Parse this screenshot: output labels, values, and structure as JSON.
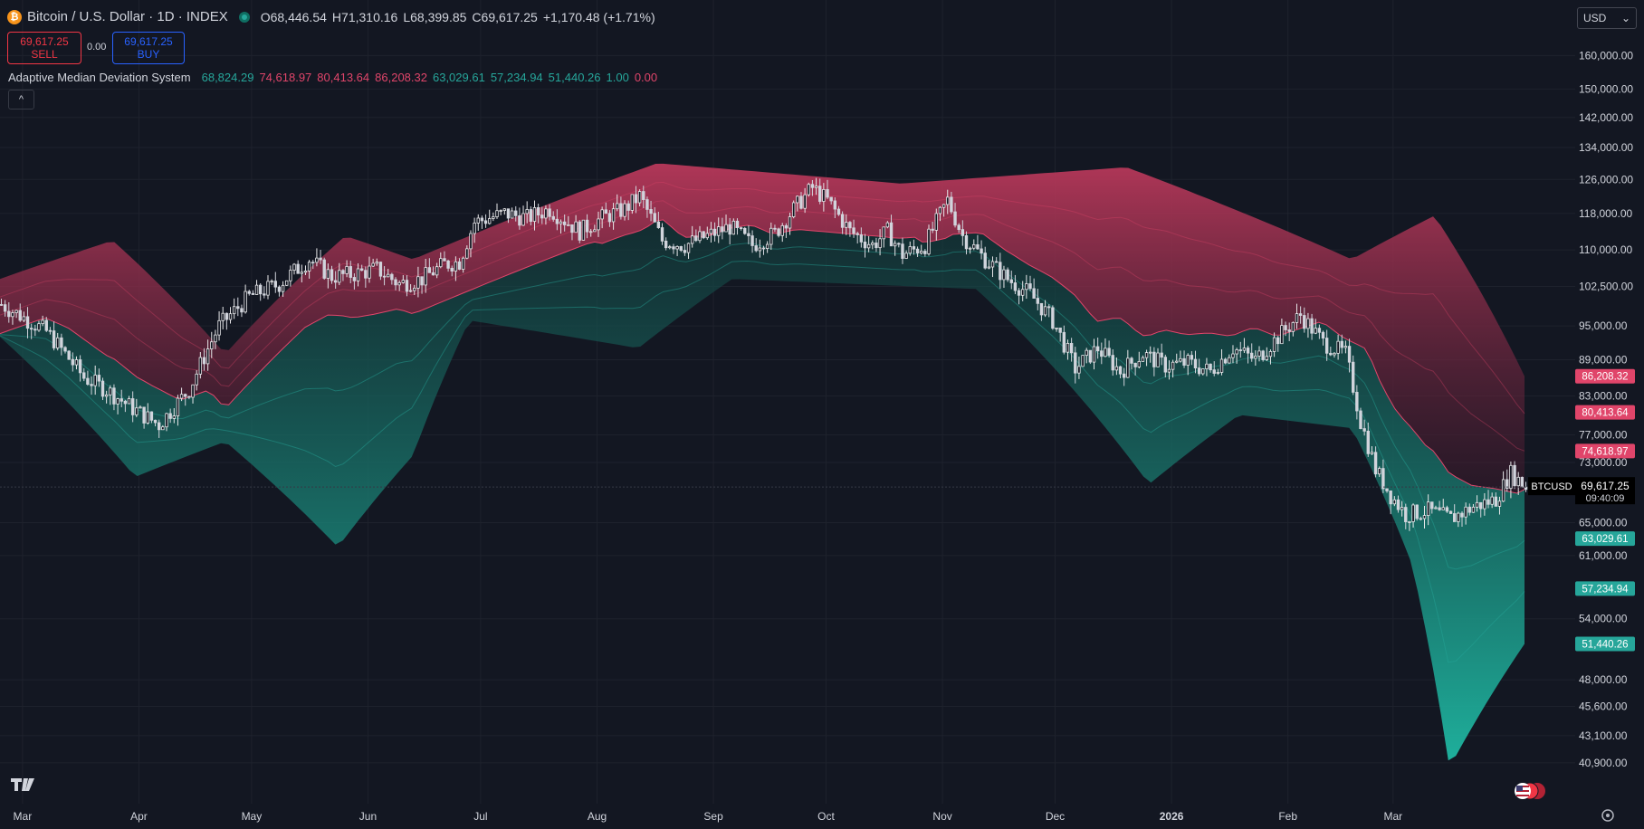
{
  "header": {
    "symbol_title": "Bitcoin / U.S. Dollar · 1D · INDEX",
    "icon": "bitcoin-icon",
    "open_label": "O",
    "open": "68,446.54",
    "high_label": "H",
    "high": "71,310.16",
    "low_label": "L",
    "low": "68,399.85",
    "close_label": "C",
    "close": "69,617.25",
    "change": "+1,170.48 (+1.71%)"
  },
  "trade": {
    "sell_price": "69,617.25",
    "sell_label": "SELL",
    "spread": "0.00",
    "buy_price": "69,617.25",
    "buy_label": "BUY"
  },
  "indicator": {
    "name": "Adaptive Median Deviation System",
    "values": [
      {
        "text": "68,824.29",
        "color": "#26a69a"
      },
      {
        "text": "74,618.97",
        "color": "#e0456a"
      },
      {
        "text": "80,413.64",
        "color": "#e0456a"
      },
      {
        "text": "86,208.32",
        "color": "#e0456a"
      },
      {
        "text": "63,029.61",
        "color": "#26a69a"
      },
      {
        "text": "57,234.94",
        "color": "#26a69a"
      },
      {
        "text": "51,440.26",
        "color": "#26a69a"
      },
      {
        "text": "1.00",
        "color": "#26a69a"
      },
      {
        "text": "0.00",
        "color": "#e0456a"
      }
    ]
  },
  "currency": {
    "value": "USD",
    "icon": "chevron-down-icon"
  },
  "colors": {
    "background": "#131722",
    "bull": "#26a69a",
    "bear": "#e0456a",
    "candle": "#d1d4dc",
    "grid": "#1e222d"
  },
  "chart_data": {
    "type": "candlestick",
    "title": "Bitcoin / U.S. Dollar · 1D · INDEX",
    "y_scale": "log",
    "ylim": [
      38000,
      172000
    ],
    "y_ticks": [
      "160,000.00",
      "150,000.00",
      "142,000.00",
      "134,000.00",
      "126,000.00",
      "118,000.00",
      "110,000.00",
      "102,500.00",
      "95,000.00",
      "89,000.00",
      "83,000.00",
      "77,000.00",
      "73,000.00",
      "65,000.00",
      "61,000.00",
      "54,000.00",
      "48,000.00",
      "45,600.00",
      "43,100.00",
      "40,900.00"
    ],
    "x_labels": [
      "Mar",
      "Apr",
      "May",
      "Jun",
      "Jul",
      "Aug",
      "Sep",
      "Oct",
      "Nov",
      "Dec",
      "2026",
      "Feb",
      "Mar"
    ],
    "grid": true,
    "series": [
      {
        "name": "BTCUSD",
        "close_points": [
          [
            0,
            99000
          ],
          [
            12,
            94000
          ],
          [
            22,
            86000
          ],
          [
            28,
            84000
          ],
          [
            35,
            81000
          ],
          [
            42,
            78500
          ],
          [
            50,
            84000
          ],
          [
            58,
            95000
          ],
          [
            66,
            100500
          ],
          [
            74,
            103000
          ],
          [
            82,
            108000
          ],
          [
            88,
            104500
          ],
          [
            94,
            105000
          ],
          [
            100,
            106000
          ],
          [
            106,
            103000
          ],
          [
            112,
            104000
          ],
          [
            118,
            107000
          ],
          [
            122,
            107500
          ],
          [
            126,
            116000
          ],
          [
            134,
            118000
          ],
          [
            140,
            117000
          ],
          [
            146,
            119000
          ],
          [
            154,
            114000
          ],
          [
            160,
            117000
          ],
          [
            166,
            119000
          ],
          [
            170,
            122000
          ],
          [
            176,
            112000
          ],
          [
            182,
            111000
          ],
          [
            188,
            113000
          ],
          [
            194,
            115000
          ],
          [
            200,
            111000
          ],
          [
            206,
            113500
          ],
          [
            212,
            120000
          ],
          [
            216,
            124000
          ],
          [
            220,
            121000
          ],
          [
            226,
            114000
          ],
          [
            232,
            111000
          ],
          [
            236,
            114000
          ],
          [
            240,
            109000
          ],
          [
            246,
            111000
          ],
          [
            252,
            121000
          ],
          [
            256,
            113000
          ],
          [
            262,
            108000
          ],
          [
            268,
            104000
          ],
          [
            274,
            101000
          ],
          [
            280,
            96000
          ],
          [
            286,
            87500
          ],
          [
            292,
            91000
          ],
          [
            298,
            87000
          ],
          [
            304,
            90000
          ],
          [
            310,
            88000
          ],
          [
            316,
            88500
          ],
          [
            322,
            87000
          ],
          [
            328,
            91000
          ],
          [
            334,
            89000
          ],
          [
            340,
            93000
          ],
          [
            346,
            97000
          ],
          [
            352,
            92000
          ],
          [
            358,
            90000
          ],
          [
            362,
            79000
          ],
          [
            366,
            72000
          ],
          [
            370,
            68500
          ],
          [
            374,
            66000
          ],
          [
            380,
            66500
          ],
          [
            386,
            65500
          ],
          [
            392,
            67000
          ],
          [
            398,
            68000
          ],
          [
            402,
            71500
          ],
          [
            406,
            69617.25
          ]
        ]
      },
      {
        "name": "Upper 3",
        "last": 86208.32,
        "points": [
          [
            0,
            104000
          ],
          [
            30,
            112000
          ],
          [
            60,
            90000
          ],
          [
            92,
            113000
          ],
          [
            110,
            108000
          ],
          [
            125,
            113000
          ],
          [
            175,
            130000
          ],
          [
            240,
            125000
          ],
          [
            300,
            129000
          ],
          [
            360,
            108000
          ],
          [
            382,
            117500
          ],
          [
            406,
            86208.32
          ]
        ]
      },
      {
        "name": "Upper 2",
        "last": 80413.64
      },
      {
        "name": "Upper 1",
        "last": 74618.97
      },
      {
        "name": "Median",
        "last": 68824.29
      },
      {
        "name": "Lower 1",
        "last": 63029.61
      },
      {
        "name": "Lower 2",
        "last": 57234.94
      },
      {
        "name": "Lower 3",
        "last": 51440.26,
        "points": [
          [
            0,
            93000
          ],
          [
            36,
            71000
          ],
          [
            60,
            76000
          ],
          [
            90,
            62000
          ],
          [
            110,
            74000
          ],
          [
            125,
            96000
          ],
          [
            170,
            91000
          ],
          [
            195,
            104000
          ],
          [
            260,
            102000
          ],
          [
            306,
            70000
          ],
          [
            330,
            80000
          ],
          [
            360,
            78000
          ],
          [
            376,
            60000
          ],
          [
            386,
            40500
          ],
          [
            406,
            51440.26
          ]
        ]
      }
    ],
    "price_label": {
      "symbol": "BTCUSD",
      "price": "69,617.25",
      "countdown": "09:40:09"
    },
    "band_labels": [
      {
        "text": "86,208.32",
        "value": 86208.32,
        "color": "#e0456a"
      },
      {
        "text": "80,413.64",
        "value": 80413.64,
        "color": "#e0456a"
      },
      {
        "text": "74,618.97",
        "value": 74618.97,
        "color": "#e0456a"
      },
      {
        "text": "68,824.29",
        "value": 68824.29,
        "color": "#26a69a"
      },
      {
        "text": "63,029.61",
        "value": 63029.61,
        "color": "#26a69a"
      },
      {
        "text": "57,234.94",
        "value": 57234.94,
        "color": "#26a69a"
      },
      {
        "text": "51,440.26",
        "value": 51440.26,
        "color": "#26a69a"
      }
    ]
  }
}
